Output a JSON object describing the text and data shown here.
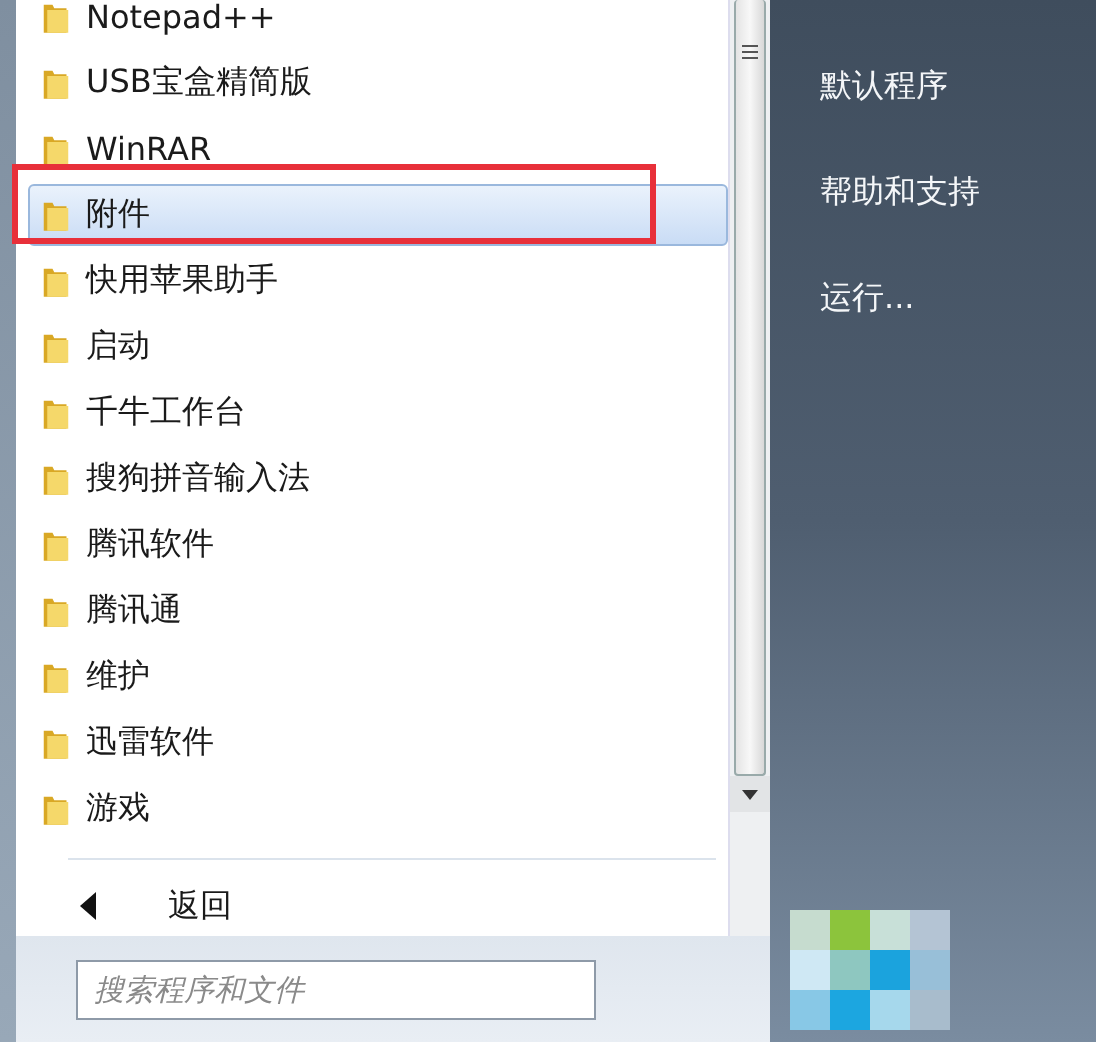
{
  "programs": [
    {
      "label": "Notepad++",
      "selected": false
    },
    {
      "label": "USB宝盒精简版",
      "selected": false
    },
    {
      "label": "WinRAR",
      "selected": false
    },
    {
      "label": "附件",
      "selected": true
    },
    {
      "label": "快用苹果助手",
      "selected": false
    },
    {
      "label": "启动",
      "selected": false
    },
    {
      "label": "千牛工作台",
      "selected": false
    },
    {
      "label": "搜狗拼音输入法",
      "selected": false
    },
    {
      "label": "腾讯软件",
      "selected": false
    },
    {
      "label": "腾讯通",
      "selected": false
    },
    {
      "label": "维护",
      "selected": false
    },
    {
      "label": "迅雷软件",
      "selected": false
    },
    {
      "label": "游戏",
      "selected": false
    }
  ],
  "back": {
    "label": "返回"
  },
  "search": {
    "placeholder": "搜索程序和文件"
  },
  "right_items": [
    "默认程序",
    "帮助和支持",
    "运行..."
  ]
}
